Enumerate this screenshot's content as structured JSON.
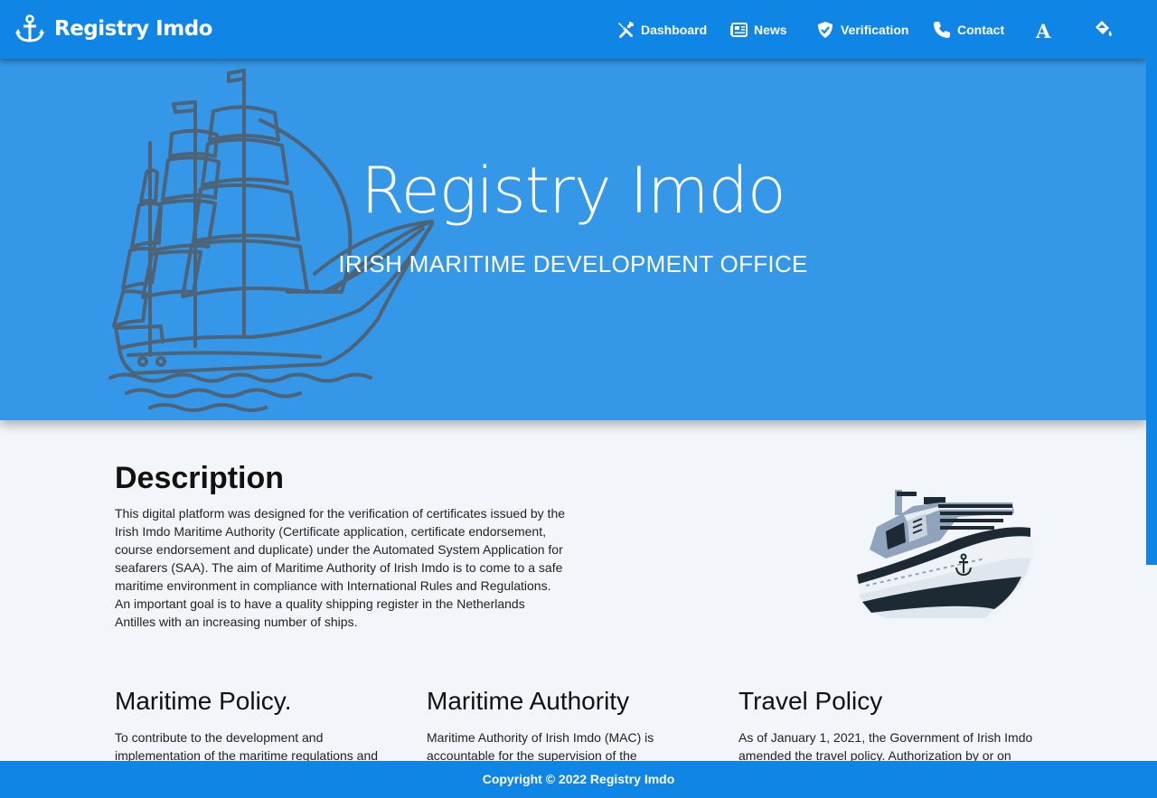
{
  "header": {
    "brand": "Registry Imdo",
    "brand_icon": "anchor-icon",
    "nav": [
      {
        "label": "Dashboard",
        "icon": "tools-icon"
      },
      {
        "label": "News",
        "icon": "newspaper-icon"
      },
      {
        "label": "Verification",
        "icon": "shield-check-icon"
      },
      {
        "label": "Contact",
        "icon": "phone-icon"
      }
    ],
    "font_toggle": "A",
    "theme_icon": "paint-bucket-icon"
  },
  "hero": {
    "title": "Registry Imdo",
    "subtitle": "IRISH MARITIME DEVELOPMENT OFFICE"
  },
  "description": {
    "title": "Description",
    "text": "This digital platform was designed for the verification of certificates issued by the Irish Imdo Maritime Authority (Certificate application, certificate endorsement, course endorsement and duplicate) under the Automated System Application for seafarers (SAA). The aim of Maritime Authority of Irish Imdo is to come to a safe maritime environment in compliance with International Rules and Regulations. An important goal is to have a quality shipping register in the Netherlands Antilles with an increasing number of ships."
  },
  "columns": [
    {
      "title": "Maritime Policy.",
      "text": "To contribute to the development and implementation of the maritime regulations and"
    },
    {
      "title": "Maritime Authority",
      "text": "Maritime Authority of Irish Imdo (MAC) is accountable for the supervision of the"
    },
    {
      "title": "Travel Policy",
      "text": "As of January 1, 2021, the Government of Irish Imdo amended the travel policy. Authorization by or on"
    }
  ],
  "footer": {
    "copyright": "Copyright © 2022 Registry Imdo"
  },
  "colors": {
    "primary": "#0f86e5",
    "hero": "#3497e8",
    "background": "#f2f5f9",
    "ship_line": "#4d6378"
  }
}
